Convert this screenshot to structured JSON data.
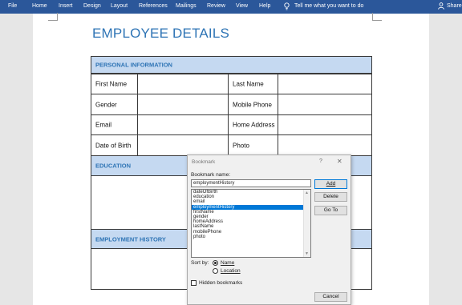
{
  "ribbon": {
    "tabs": [
      "File",
      "Home",
      "Insert",
      "Design",
      "Layout",
      "References",
      "Mailings",
      "Review",
      "View",
      "Help"
    ],
    "tell_me": "Tell me what you want to do",
    "share": "Share"
  },
  "document": {
    "title": "EMPLOYEE DETAILS",
    "personal_section": "PERSONAL INFORMATION",
    "fields_left": [
      "First Name",
      "Gender",
      "Email",
      "Date of Birth"
    ],
    "fields_right": [
      "Last Name",
      "Mobile Phone",
      "Home Address",
      "Photo"
    ],
    "education_section": "EDUCATION",
    "employment_section": "EMPLOYMENT HISTORY"
  },
  "dialog": {
    "title": "Bookmark",
    "help": "?",
    "close": "✕",
    "name_label": "Bookmark name:",
    "name_value": "employmentHistory",
    "items": [
      "dateOfBirth",
      "education",
      "email",
      "employmentHistory",
      "firstName",
      "gender",
      "homeAddress",
      "lastName",
      "mobilePhone",
      "photo"
    ],
    "selected_item": "employmentHistory",
    "add_label": "Add",
    "delete_label": "Delete",
    "goto_label": "Go To",
    "sort_label": "Sort by:",
    "sort_name": "Name",
    "sort_location": "Location",
    "sort_selected": "Name",
    "hidden_label": "Hidden bookmarks",
    "hidden_checked": false,
    "cancel_label": "Cancel"
  }
}
